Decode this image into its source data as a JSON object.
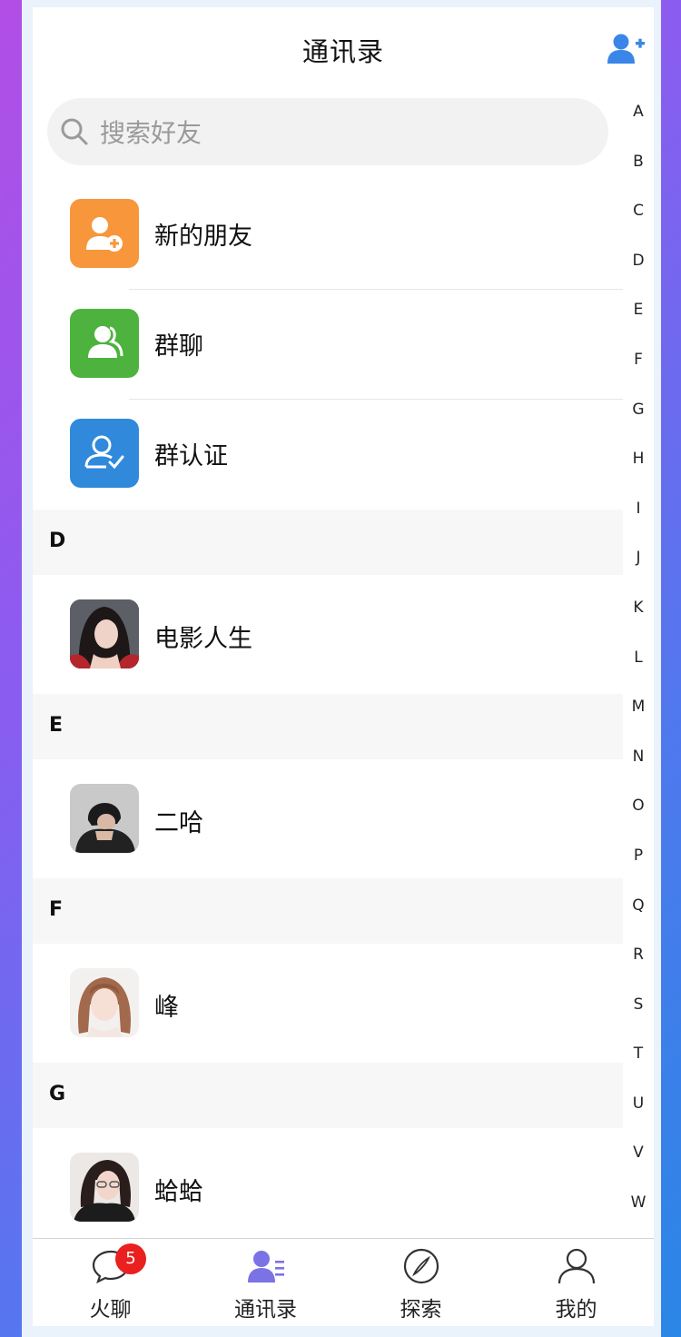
{
  "header": {
    "title": "通讯录"
  },
  "search": {
    "placeholder": "搜索好友"
  },
  "menu": [
    {
      "label": "新的朋友",
      "icon": "new-friend-icon",
      "color": "#f7963a"
    },
    {
      "label": "群聊",
      "icon": "group-chat-icon",
      "color": "#4eb23f"
    },
    {
      "label": "群认证",
      "icon": "group-verify-icon",
      "color": "#3089db"
    }
  ],
  "sections": [
    {
      "letter": "D",
      "contacts": [
        {
          "name": "电影人生"
        }
      ]
    },
    {
      "letter": "E",
      "contacts": [
        {
          "name": "二哈"
        }
      ]
    },
    {
      "letter": "F",
      "contacts": [
        {
          "name": "峰"
        }
      ]
    },
    {
      "letter": "G",
      "contacts": [
        {
          "name": "蛤蛤"
        }
      ]
    }
  ],
  "index": [
    "A",
    "B",
    "C",
    "D",
    "E",
    "F",
    "G",
    "H",
    "I",
    "J",
    "K",
    "L",
    "M",
    "N",
    "O",
    "P",
    "Q",
    "R",
    "S",
    "T",
    "U",
    "V",
    "W"
  ],
  "tabs": [
    {
      "label": "火聊",
      "icon": "chat-bubble-icon",
      "badge": "5"
    },
    {
      "label": "通讯录",
      "icon": "contacts-icon",
      "active": true
    },
    {
      "label": "探索",
      "icon": "compass-icon"
    },
    {
      "label": "我的",
      "icon": "profile-icon"
    }
  ],
  "colors": {
    "accent": "#3a86e8",
    "active_tab": "#7b72e6",
    "badge": "#e9201f"
  }
}
